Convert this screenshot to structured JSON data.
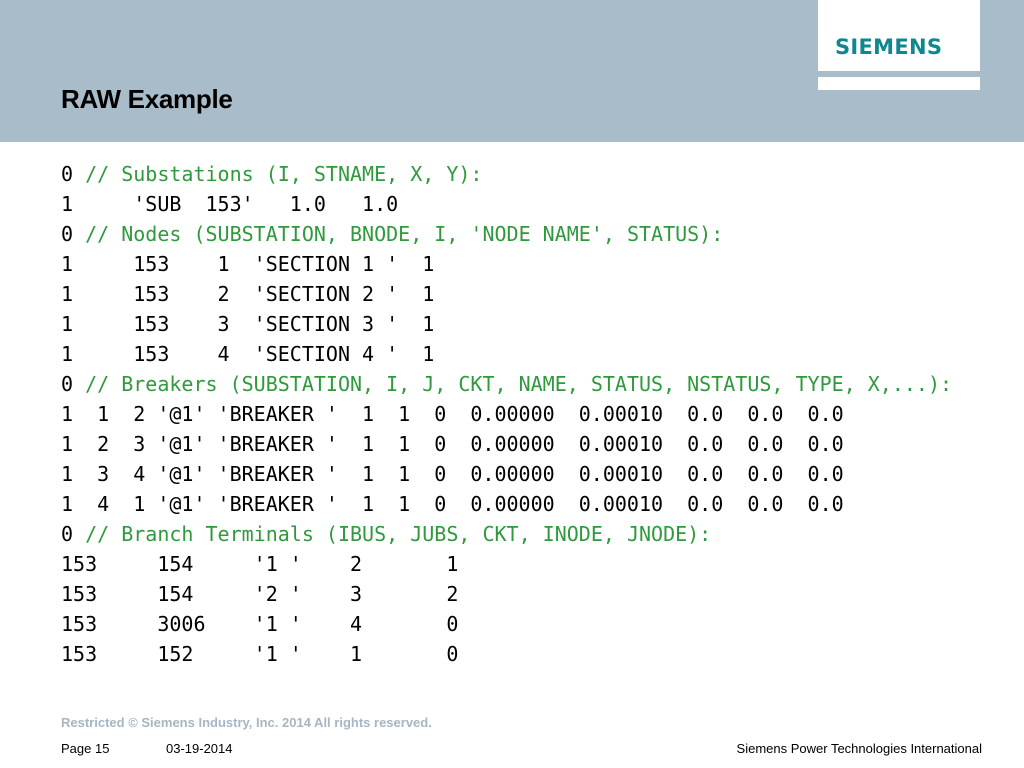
{
  "header": {
    "title": "RAW Example",
    "logo_text": "SIEMENS"
  },
  "code_lines": [
    {
      "prefix": "0 ",
      "comment": "// Substations (I, STNAME, X, Y):"
    },
    {
      "prefix": "1     'SUB  153'   1.0   1.0",
      "comment": ""
    },
    {
      "prefix": "0 ",
      "comment": "// Nodes (SUBSTATION, BNODE, I, 'NODE NAME', STATUS):"
    },
    {
      "prefix": "1     153    1  'SECTION 1 '  1",
      "comment": ""
    },
    {
      "prefix": "1     153    2  'SECTION 2 '  1",
      "comment": ""
    },
    {
      "prefix": "1     153    3  'SECTION 3 '  1",
      "comment": ""
    },
    {
      "prefix": "1     153    4  'SECTION 4 '  1",
      "comment": ""
    },
    {
      "prefix": "0 ",
      "comment": "// Breakers (SUBSTATION, I, J, CKT, NAME, STATUS, NSTATUS, TYPE, X,...):"
    },
    {
      "prefix": "1  1  2 '@1' 'BREAKER '  1  1  0  0.00000  0.00010  0.0  0.0  0.0",
      "comment": ""
    },
    {
      "prefix": "1  2  3 '@1' 'BREAKER '  1  1  0  0.00000  0.00010  0.0  0.0  0.0",
      "comment": ""
    },
    {
      "prefix": "1  3  4 '@1' 'BREAKER '  1  1  0  0.00000  0.00010  0.0  0.0  0.0",
      "comment": ""
    },
    {
      "prefix": "1  4  1 '@1' 'BREAKER '  1  1  0  0.00000  0.00010  0.0  0.0  0.0",
      "comment": ""
    },
    {
      "prefix": "0 ",
      "comment": "// Branch Terminals (IBUS, JUBS, CKT, INODE, JNODE):"
    },
    {
      "prefix": "153     154     '1 '    2       1",
      "comment": ""
    },
    {
      "prefix": "153     154     '2 '    3       2",
      "comment": ""
    },
    {
      "prefix": "153     3006    '1 '    4       0",
      "comment": ""
    },
    {
      "prefix": "153     152     '1 '    1       0",
      "comment": ""
    }
  ],
  "footer": {
    "restricted": "Restricted © Siemens Industry, Inc. 2014 All rights reserved.",
    "page": "Page 15",
    "date": "03-19-2014",
    "company": "Siemens Power Technologies International"
  },
  "colors": {
    "header_band": "#a9bcc9",
    "logo": "#0f8790",
    "comment": "#2e9a3c",
    "restricted_text": "#a6b6c3"
  }
}
